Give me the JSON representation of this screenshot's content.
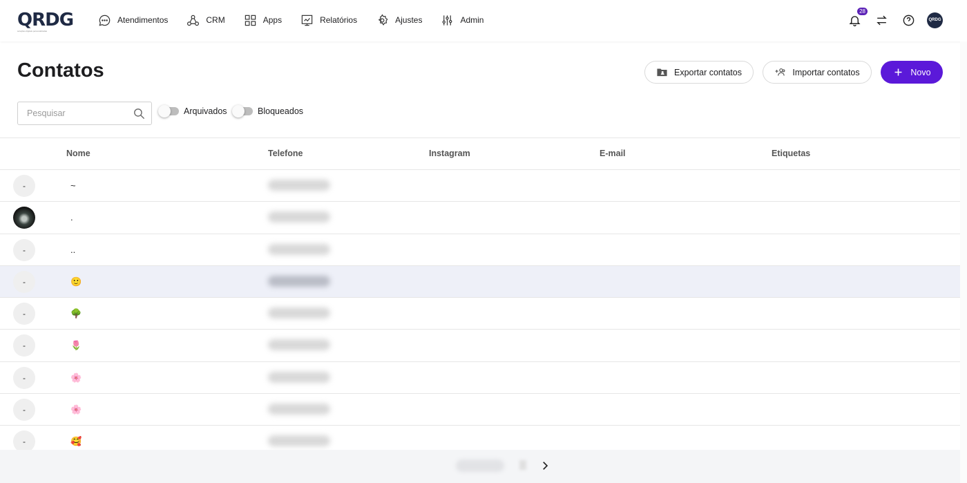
{
  "brand": {
    "name": "QRDG",
    "tagline": "soluções digitais personalizadas"
  },
  "nav": [
    {
      "label": "Atendimentos",
      "icon": "chat-icon"
    },
    {
      "label": "CRM",
      "icon": "crm-nodes-icon"
    },
    {
      "label": "Apps",
      "icon": "grid-icon"
    },
    {
      "label": "Relatórios",
      "icon": "report-icon"
    },
    {
      "label": "Ajustes",
      "icon": "gear-icon"
    },
    {
      "label": "Admin",
      "icon": "sliders-icon"
    }
  ],
  "topbar": {
    "notifications_count": "28",
    "avatar_text": "QRDG"
  },
  "page": {
    "title": "Contatos"
  },
  "actions": {
    "export": "Exportar contatos",
    "import": "Importar contatos",
    "new": "Novo"
  },
  "filters": {
    "search_placeholder": "Pesquisar",
    "archived": "Arquivados",
    "blocked": "Bloqueados"
  },
  "table": {
    "columns": [
      "Nome",
      "Telefone",
      "Instagram",
      "E-mail",
      "Etiquetas"
    ],
    "rows": [
      {
        "avatar": "-",
        "name": "~"
      },
      {
        "avatar": "",
        "name": "."
      },
      {
        "avatar": "-",
        "name": ".."
      },
      {
        "avatar": "-",
        "name": "🙂"
      },
      {
        "avatar": "-",
        "name": "🌳"
      },
      {
        "avatar": "-",
        "name": "🌷"
      },
      {
        "avatar": "-",
        "name": "🌸"
      },
      {
        "avatar": "-",
        "name": "🌸"
      },
      {
        "avatar": "-",
        "name": "🥰"
      }
    ]
  },
  "colors": {
    "primary": "#5b19d9",
    "badge": "#5b21b6",
    "highlight_row": "#eef0f8"
  }
}
